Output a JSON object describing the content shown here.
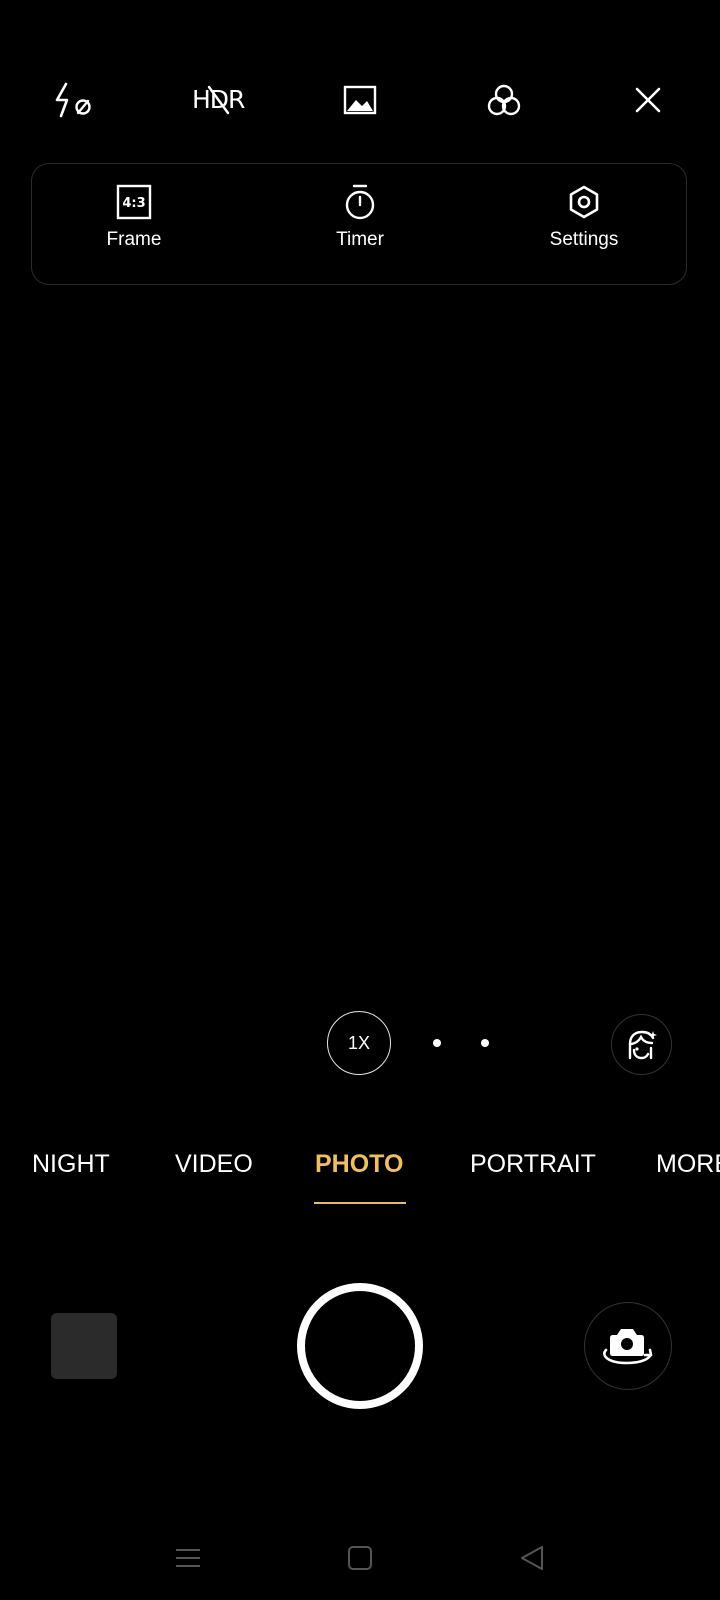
{
  "top_toolbar": {
    "flash_icon": "flash-off-icon",
    "hdr_label": "HDR",
    "hdr_icon": "hdr-off-icon",
    "gallery_icon": "image-icon",
    "filter_icon": "filter-circles-icon",
    "close_icon": "close-icon"
  },
  "quick_settings": {
    "items": [
      {
        "label": "Frame",
        "icon": "aspect-ratio-icon",
        "icon_text": "4:3"
      },
      {
        "label": "Timer",
        "icon": "timer-icon"
      },
      {
        "label": "Settings",
        "icon": "settings-icon"
      }
    ]
  },
  "zoom": {
    "current": "1X"
  },
  "beauty_icon": "face-beauty-icon",
  "modes": {
    "items": [
      "NIGHT",
      "VIDEO",
      "PHOTO",
      "PORTRAIT",
      "MORE"
    ],
    "active": "PHOTO"
  },
  "shutter_row": {
    "thumbnail_icon": "gallery-thumbnail",
    "shutter_icon": "shutter-button",
    "flip_icon": "flip-camera-icon"
  },
  "nav_bar": {
    "menu_icon": "menu-icon",
    "home_icon": "home-icon",
    "back_icon": "back-icon"
  },
  "colors": {
    "background": "#000000",
    "active_mode": "#f0c060",
    "text": "#ffffff"
  }
}
